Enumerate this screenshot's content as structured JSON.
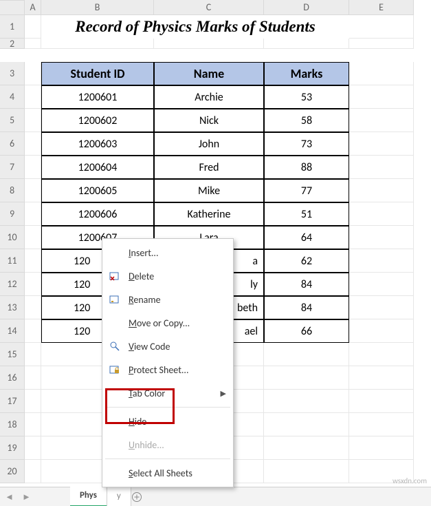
{
  "columns": [
    "A",
    "B",
    "C",
    "D",
    "E"
  ],
  "row_labels": [
    "1",
    "2",
    "3",
    "4",
    "5",
    "6",
    "7",
    "8",
    "9",
    "10",
    "11",
    "12",
    "13",
    "14",
    "15",
    "16",
    "17",
    "18",
    "19",
    "20"
  ],
  "title": "Record of Physics Marks of Students",
  "table": {
    "headers": [
      "Student ID",
      "Name",
      "Marks"
    ],
    "rows": [
      {
        "id": "1200601",
        "name": "Archie",
        "marks": "53"
      },
      {
        "id": "1200602",
        "name": "Nick",
        "marks": "58"
      },
      {
        "id": "1200603",
        "name": "John",
        "marks": "73"
      },
      {
        "id": "1200604",
        "name": "Fred",
        "marks": "88"
      },
      {
        "id": "1200605",
        "name": "Mike",
        "marks": "77"
      },
      {
        "id": "1200606",
        "name": "Katherine",
        "marks": "51"
      },
      {
        "id": "1200607",
        "name": "Lara",
        "marks": "64"
      },
      {
        "id": "1200608",
        "name": "Mira",
        "marks": "62"
      },
      {
        "id": "1200609",
        "name": "Emily",
        "marks": "84"
      },
      {
        "id": "1200610",
        "name": "Elizabeth",
        "marks": "84"
      },
      {
        "id": "1200611",
        "name": "Michael",
        "marks": "66"
      }
    ],
    "truncated_ids": [
      "120",
      "120",
      "120",
      "120"
    ]
  },
  "tabs": {
    "active": "Phys",
    "hidden": "y"
  },
  "context_menu": {
    "insert": "Insert...",
    "delete": "Delete",
    "rename": "Rename",
    "move": "Move or Copy...",
    "view_code": "View Code",
    "protect": "Protect Sheet...",
    "tab_color": "Tab Color",
    "hide": "Hide",
    "unhide": "Unhide...",
    "select_all": "Select All Sheets"
  },
  "watermark": "wsxdn.com"
}
